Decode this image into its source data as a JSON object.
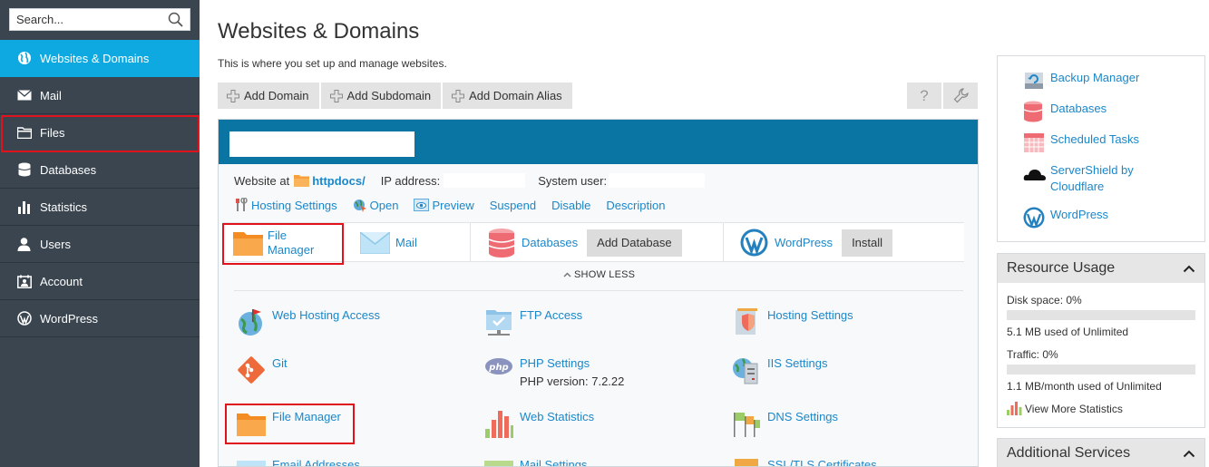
{
  "sidebar": {
    "search_placeholder": "Search...",
    "items": [
      {
        "label": "Websites & Domains",
        "icon": "globe-icon"
      },
      {
        "label": "Mail",
        "icon": "envelope-icon"
      },
      {
        "label": "Files",
        "icon": "folder-icon"
      },
      {
        "label": "Databases",
        "icon": "database-icon"
      },
      {
        "label": "Statistics",
        "icon": "bar-chart-icon"
      },
      {
        "label": "Users",
        "icon": "user-icon"
      },
      {
        "label": "Account",
        "icon": "account-icon"
      },
      {
        "label": "WordPress",
        "icon": "wordpress-icon"
      }
    ]
  },
  "main": {
    "title": "Websites & Domains",
    "description": "This is where you set up and manage websites.",
    "toolbar": {
      "add_domain": "Add Domain",
      "add_subdomain": "Add Subdomain",
      "add_domain_alias": "Add Domain Alias",
      "help_glyph": "?"
    }
  },
  "domain": {
    "website_at": "Website at",
    "docroot": "httpdocs/",
    "ip_label": "IP address:",
    "user_label": "System user:",
    "actions": {
      "hosting_settings": "Hosting Settings",
      "open": "Open",
      "preview": "Preview",
      "suspend": "Suspend",
      "disable": "Disable",
      "description": "Description"
    },
    "quick": {
      "file_manager_line1": "File",
      "file_manager_line2": "Manager",
      "mail": "Mail",
      "databases": "Databases",
      "add_database": "Add Database",
      "wordpress": "WordPress",
      "install": "Install"
    },
    "show_less": "SHOW LESS",
    "tools": {
      "web_hosting_access": "Web Hosting Access",
      "ftp_access": "FTP Access",
      "hosting_settings": "Hosting Settings",
      "git": "Git",
      "php_settings": "PHP Settings",
      "php_version": "PHP version: 7.2.22",
      "iis_settings": "IIS Settings",
      "file_manager": "File Manager",
      "web_statistics": "Web Statistics",
      "dns_settings": "DNS Settings",
      "email_addresses": "Email Addresses",
      "mail_settings": "Mail Settings",
      "ssl_certificates": "SSL/TLS Certificates"
    }
  },
  "right": {
    "links": {
      "backup_manager": "Backup Manager",
      "databases": "Databases",
      "scheduled_tasks": "Scheduled Tasks",
      "servershield_line1": "ServerShield by",
      "servershield_line2": "Cloudflare",
      "wordpress": "WordPress"
    },
    "resource_usage": {
      "title": "Resource Usage",
      "disk_space": "Disk space: 0%",
      "disk_used": "5.1 MB used of Unlimited",
      "disk_fraction": 0,
      "traffic": "Traffic: 0%",
      "traffic_used": "1.1 MB/month used of Unlimited",
      "traffic_fraction": 0,
      "view_more": "View More Statistics"
    },
    "additional_services": {
      "title": "Additional Services"
    }
  },
  "colors": {
    "sidebar_bg": "#3a4550",
    "active_nav": "#0fa9e2",
    "panel_header": "#0a75a2",
    "link": "#1b87c9",
    "highlight_red": "#e0121b"
  }
}
